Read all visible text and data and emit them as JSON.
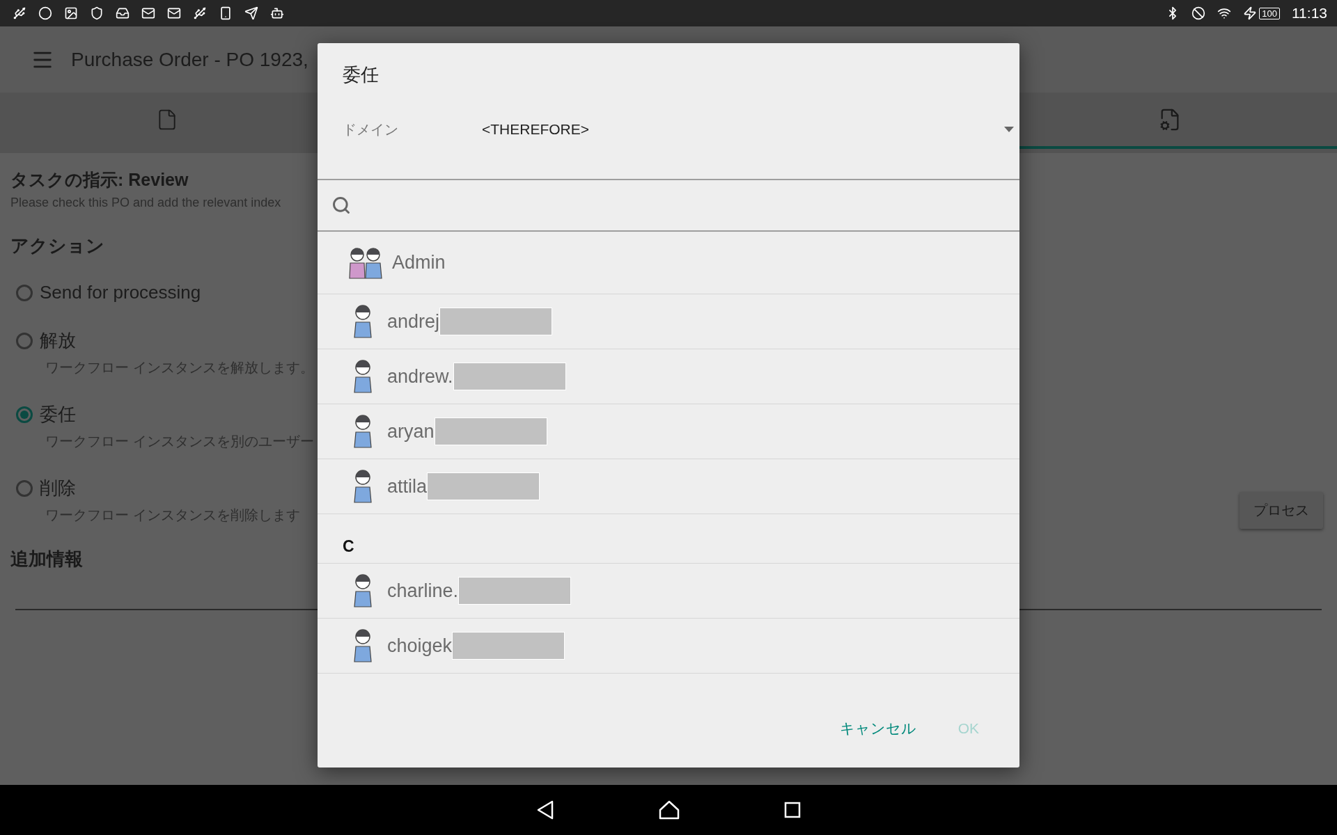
{
  "status_bar": {
    "battery": "100",
    "time": "11:13"
  },
  "app_bar": {
    "title": "Purchase Order - PO 1923,"
  },
  "tabs": [
    {
      "kind": "document",
      "selected": false
    },
    {
      "kind": "workflow",
      "selected": true
    }
  ],
  "task": {
    "heading": "タスクの指示: Review",
    "instructions": "Please check this PO and add the relevant index"
  },
  "actions": {
    "heading": "アクション",
    "options": [
      {
        "label": "Send for processing",
        "selected": false
      },
      {
        "label": "解放",
        "description": "ワークフロー インスタンスを解放します。",
        "selected": false
      },
      {
        "label": "委任",
        "description": "ワークフロー インスタンスを別のユーザー",
        "selected": true
      },
      {
        "label": "削除",
        "description": "ワークフロー インスタンスを削除します",
        "selected": false
      }
    ]
  },
  "additional_info": {
    "heading": "追加情報"
  },
  "process_button": {
    "label": "プロセス"
  },
  "dialog": {
    "title": "委任",
    "domain_label": "ドメイン",
    "domain_value": "<THEREFORE>",
    "items": [
      {
        "kind": "group",
        "name": "Admin",
        "redacted": false
      },
      {
        "kind": "user",
        "name": "andrej",
        "redacted": true
      },
      {
        "kind": "user",
        "name": "andrew.",
        "redacted": true
      },
      {
        "kind": "user",
        "name": "aryan",
        "redacted": true
      },
      {
        "kind": "user",
        "name": "attila",
        "redacted": true
      },
      {
        "kind": "header",
        "name": "C"
      },
      {
        "kind": "user",
        "name": "charline.",
        "redacted": true
      },
      {
        "kind": "user",
        "name": "choigek",
        "redacted": true
      }
    ],
    "buttons": [
      {
        "label": "キャンセル",
        "disabled": false
      },
      {
        "label": "OK",
        "disabled": true
      }
    ]
  }
}
